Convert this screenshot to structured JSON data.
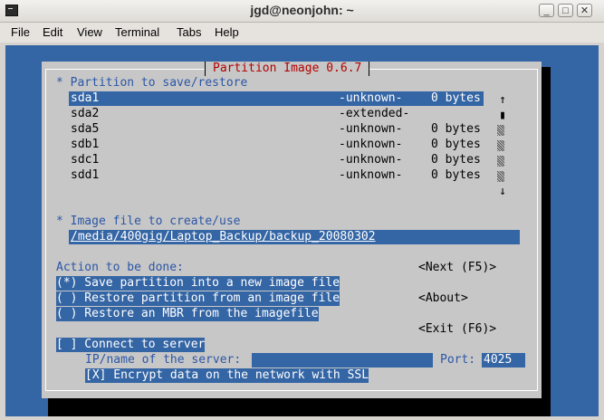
{
  "window": {
    "title": "jgd@neonjohn: ~",
    "minimize": "_",
    "maximize": "□",
    "close": "✕"
  },
  "menu": [
    "File",
    "Edit",
    "View",
    "Terminal",
    "Tabs",
    "Help"
  ],
  "dialog": {
    "title": "Partition Image 0.6.7",
    "partition_heading": "* Partition to save/restore",
    "partitions": [
      {
        "name": "sda1",
        "type": "-unknown-",
        "size": "0 bytes",
        "selected": true
      },
      {
        "name": "sda2",
        "type": "-extended-",
        "size": ""
      },
      {
        "name": "sda5",
        "type": "-unknown-",
        "size": "0 bytes"
      },
      {
        "name": "sdb1",
        "type": "-unknown-",
        "size": "0 bytes"
      },
      {
        "name": "sdc1",
        "type": "-unknown-",
        "size": "0 bytes"
      },
      {
        "name": "sdd1",
        "type": "-unknown-",
        "size": "0 bytes"
      }
    ],
    "scroll_up": "↑",
    "scroll_thumb": "▮",
    "scroll_down": "↓",
    "image_heading": "* Image file to create/use",
    "image_path": "/media/400gig/Laptop_Backup/backup_20080302",
    "action_heading": "Action to be done:",
    "actions": [
      "(*) Save partition into a new image file",
      "( ) Restore partition from an image file",
      "( ) Restore an MBR from the imagefile"
    ],
    "next_button": "<Next (F5)>",
    "about_button": "<About>",
    "exit_button": "<Exit (F6)>",
    "connect_label": "[ ] Connect to server",
    "server_label": "IP/name of the server:",
    "server_value": "",
    "port_label": "Port:",
    "port_value": "4025",
    "ssl_label": "[X] Encrypt data on the network with SSL"
  }
}
